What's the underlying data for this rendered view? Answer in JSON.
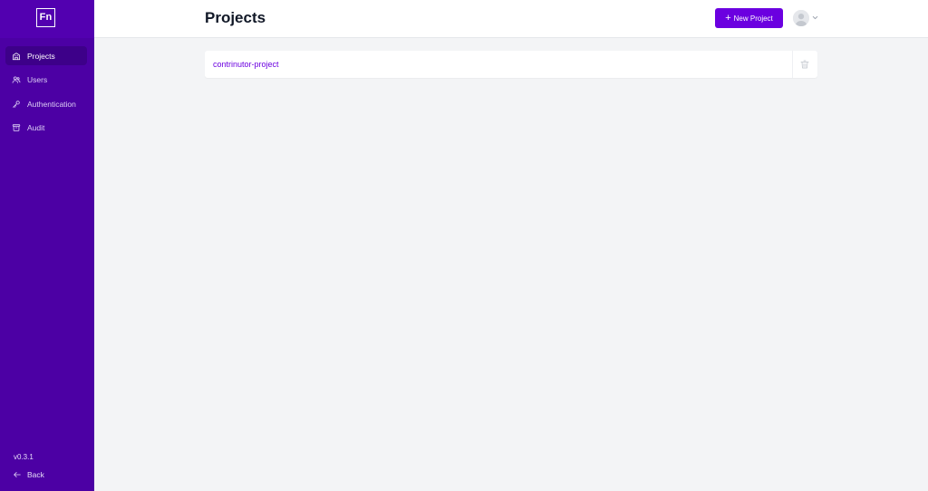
{
  "sidebar": {
    "logo": "Fn",
    "items": [
      {
        "label": "Projects",
        "icon": "building-icon",
        "active": true
      },
      {
        "label": "Users",
        "icon": "users-icon"
      },
      {
        "label": "Authentication",
        "icon": "key-icon"
      },
      {
        "label": "Audit",
        "icon": "archive-icon"
      }
    ],
    "version": "v0.3.1",
    "back_label": "Back",
    "back_icon": "arrow-left-icon"
  },
  "header": {
    "title": "Projects",
    "new_project_label": "New Project",
    "new_project_icon": "plus-icon",
    "avatar_icon": "user-avatar-icon",
    "menu_icon": "chevron-down-icon"
  },
  "projects": [
    {
      "name": "contrinutor-project",
      "action_icon": "trash-icon"
    }
  ],
  "colors": {
    "sidebar_bg": "#4c00a4",
    "accent": "#6b00e0",
    "page_bg": "#f3f4f6"
  }
}
